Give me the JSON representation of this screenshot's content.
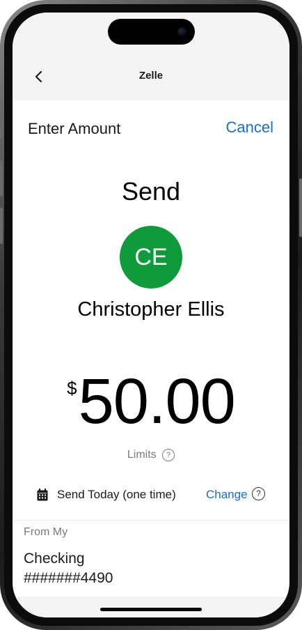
{
  "nav": {
    "title": "Zelle",
    "back_icon": "chevron-left-icon"
  },
  "header": {
    "title": "Enter Amount",
    "cancel_label": "Cancel"
  },
  "send": {
    "label": "Send",
    "recipient_initials": "CE",
    "recipient_name": "Christopher Ellis",
    "avatar_color": "#0f9a3c"
  },
  "amount": {
    "currency_symbol": "$",
    "value": "50.00"
  },
  "limits": {
    "label": "Limits",
    "help_glyph": "?"
  },
  "schedule": {
    "icon": "calendar-icon",
    "label": "Send Today (one time)",
    "change_label": "Change",
    "help_glyph": "?"
  },
  "from": {
    "label": "From My",
    "account_name": "Checking",
    "account_number": "#######4490"
  },
  "colors": {
    "accent": "#1a6dd1",
    "avatar": "#0f9a3c",
    "muted_text": "#7a7a7a",
    "nav_background": "#f4f4f4"
  }
}
